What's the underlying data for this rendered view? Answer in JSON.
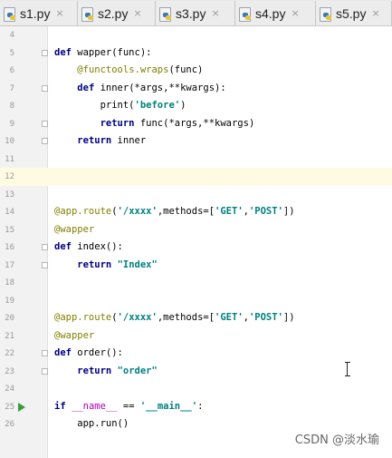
{
  "tabs": [
    {
      "label": "s1.py"
    },
    {
      "label": "s2.py"
    },
    {
      "label": "s3.py"
    },
    {
      "label": "s4.py"
    },
    {
      "label": "s5.py"
    }
  ],
  "tab_close_glyph": "×",
  "lines": [
    {
      "n": "4",
      "html": ""
    },
    {
      "n": "5",
      "html": "<span class=\"kw\">def</span> wapper(func):"
    },
    {
      "n": "6",
      "html": "    <span class=\"dec\">@functools.wraps</span>(func)"
    },
    {
      "n": "7",
      "html": "    <span class=\"kw\">def</span> inner(*args,**kwargs):"
    },
    {
      "n": "8",
      "html": "        print(<span class=\"str\">'before'</span>)"
    },
    {
      "n": "9",
      "html": "        <span class=\"kw\">return</span> func(*args,**kwargs)"
    },
    {
      "n": "10",
      "html": "    <span class=\"kw\">return</span> inner"
    },
    {
      "n": "11",
      "html": ""
    },
    {
      "n": "12",
      "html": "",
      "current": true
    },
    {
      "n": "13",
      "html": ""
    },
    {
      "n": "14",
      "html": "<span class=\"dec\">@app.route</span>(<span class=\"str\">'/xxxx'</span>,methods=[<span class=\"str\">'GET'</span>,<span class=\"str\">'POST'</span>])"
    },
    {
      "n": "15",
      "html": "<span class=\"dec\">@wapper</span>"
    },
    {
      "n": "16",
      "html": "<span class=\"kw\">def</span> index():"
    },
    {
      "n": "17",
      "html": "    <span class=\"kw\">return</span> <span class=\"str\">\"Index\"</span>"
    },
    {
      "n": "18",
      "html": ""
    },
    {
      "n": "19",
      "html": ""
    },
    {
      "n": "20",
      "html": "<span class=\"dec\">@app.route</span>(<span class=\"str\">'/xxxx'</span>,methods=[<span class=\"str\">'GET'</span>,<span class=\"str\">'POST'</span>])"
    },
    {
      "n": "21",
      "html": "<span class=\"dec\">@wapper</span>"
    },
    {
      "n": "22",
      "html": "<span class=\"kw\">def</span> order():"
    },
    {
      "n": "23",
      "html": "    <span class=\"kw\">return</span> <span class=\"str\">\"order\"</span>"
    },
    {
      "n": "24",
      "html": ""
    },
    {
      "n": "25",
      "html": "<span class=\"kw\">if</span> <span class=\"dun\">__name__</span> == <span class=\"str\">'__main__'</span>:",
      "run": true
    },
    {
      "n": "26",
      "html": "    app.run()"
    }
  ],
  "watermark": "CSDN @淡水瑜",
  "colors": {
    "keyword": "#000080",
    "decorator": "#808000",
    "string": "#008080",
    "current_line": "#fffbe3",
    "run_arrow": "#3c9a3c"
  }
}
